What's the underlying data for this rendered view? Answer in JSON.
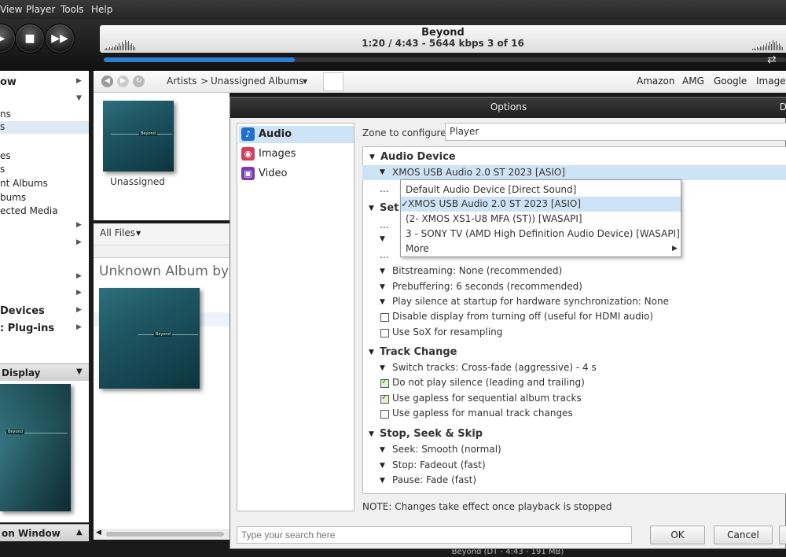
{
  "menu": {
    "view": "View",
    "player": "Player",
    "tools": "Tools",
    "help": "Help"
  },
  "now_playing": {
    "title": "Beyond",
    "info": "1:20 / 4:43 - 5644 kbps  3 of 16",
    "progress": 0.28
  },
  "sidebar": {
    "items": [
      {
        "label": "ow",
        "bold": true
      },
      {
        "label": "ns"
      },
      {
        "label": "s"
      },
      {
        "label": "es"
      },
      {
        "label": "s"
      },
      {
        "label": "nt Albums"
      },
      {
        "label": "bums"
      },
      {
        "label": "ected Media"
      },
      {
        "label": "Devices"
      },
      {
        "label": ": Plug-ins"
      }
    ],
    "display_header": "Display",
    "action_window": "on Window"
  },
  "nav": {
    "crumb_artists": "Artists",
    "crumb_sep": ">",
    "crumb_albums": "Unassigned Albums",
    "links": [
      "Amazon",
      "AMG",
      "Google",
      "Images"
    ]
  },
  "center": {
    "album_caption": "Unassigned",
    "files_label": "All Files",
    "album_heading": "Unknown Album by U"
  },
  "dialog": {
    "title": "Options",
    "close_glyph": "D",
    "categories": [
      {
        "label": "Audio",
        "icon": "music-note-icon",
        "color": "#1e6fd0"
      },
      {
        "label": "Images",
        "icon": "camera-icon",
        "color": "#d0405a"
      },
      {
        "label": "Video",
        "icon": "film-icon",
        "color": "#7a3ab0"
      }
    ],
    "zone_label": "Zone to configure:",
    "zone_value": "Player",
    "section_audio_device": "Audio Device",
    "selected_device": "XMOS USB Audio 2.0 ST 2023 [ASIO]",
    "dots": "...",
    "partial_set": "Set",
    "dropdown": [
      {
        "label": "Default Audio Device [Direct Sound]",
        "checked": false
      },
      {
        "label": "XMOS USB Audio 2.0 ST 2023 [ASIO]",
        "checked": true
      },
      {
        "label": "(2- XMOS XS1-U8 MFA (ST)) [WASAPI]",
        "checked": false
      },
      {
        "label": "3 - SONY TV (AMD High Definition Audio Device) [WASAPI]",
        "checked": false
      },
      {
        "label": "More",
        "checked": false
      }
    ],
    "settings": {
      "bitstreaming": "Bitstreaming: None (recommended)",
      "prebuffering": "Prebuffering: 6 seconds (recommended)",
      "play_silence": "Play silence at startup for hardware synchronization: None",
      "disable_display": "Disable display from turning off (useful for HDMI audio)",
      "sox": "Use SoX for resampling"
    },
    "section_track_change": "Track Change",
    "track": {
      "switch": "Switch tracks: Cross-fade (aggressive) - 4 s",
      "no_silence": "Do not play silence (leading and trailing)",
      "gapless_seq": "Use gapless for sequential album tracks",
      "gapless_manual": "Use gapless for manual track changes"
    },
    "section_stop_seek": "Stop, Seek & Skip",
    "seek": {
      "seek": "Seek: Smooth (normal)",
      "stop": "Stop: Fadeout (fast)",
      "pause": "Pause: Fade (fast)"
    },
    "note": "NOTE: Changes take effect once playback is stopped",
    "search_placeholder": "Type your search here",
    "ok": "OK",
    "cancel": "Cancel"
  },
  "status_bar": "Beyond (DT - 4:43 - 191 MB)"
}
